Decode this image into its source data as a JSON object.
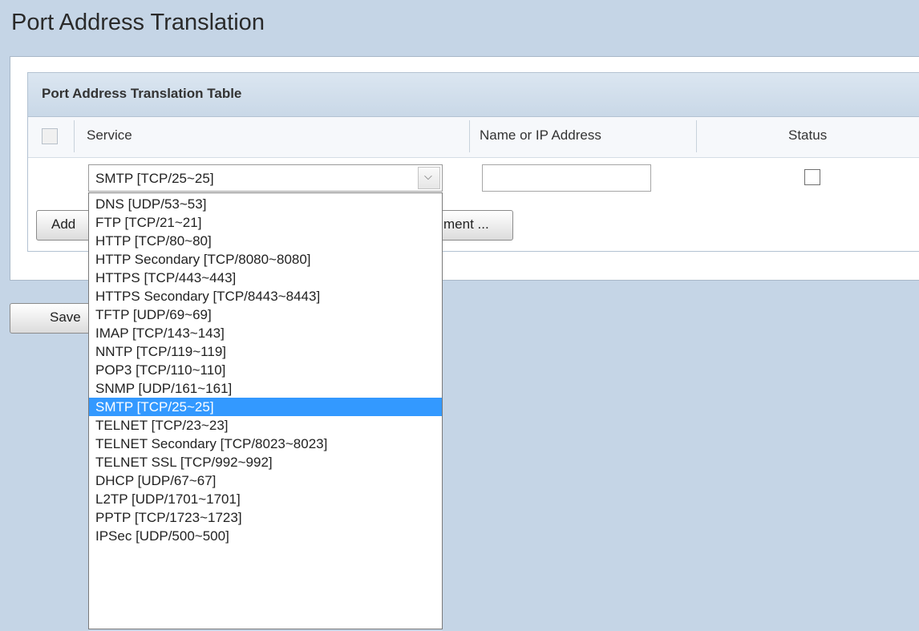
{
  "page": {
    "title": "Port Address Translation"
  },
  "table": {
    "title": "Port Address Translation Table",
    "columns": {
      "service": "Service",
      "name_or_ip": "Name or IP Address",
      "status": "Status"
    }
  },
  "row": {
    "service_selected": "SMTP [TCP/25~25]",
    "name_or_ip_value": "",
    "status_checked": false
  },
  "buttons": {
    "add_visible": "Add",
    "service_management_visible": "ment ...",
    "save_visible": "Save"
  },
  "dropdown": {
    "options": [
      "DNS [UDP/53~53]",
      "FTP [TCP/21~21]",
      "HTTP [TCP/80~80]",
      "HTTP Secondary [TCP/8080~8080]",
      "HTTPS [TCP/443~443]",
      "HTTPS Secondary [TCP/8443~8443]",
      "TFTP [UDP/69~69]",
      "IMAP [TCP/143~143]",
      "NNTP [TCP/119~119]",
      "POP3 [TCP/110~110]",
      "SNMP [UDP/161~161]",
      "SMTP [TCP/25~25]",
      "TELNET [TCP/23~23]",
      "TELNET Secondary [TCP/8023~8023]",
      "TELNET SSL [TCP/992~992]",
      "DHCP [UDP/67~67]",
      "L2TP [UDP/1701~1701]",
      "PPTP [TCP/1723~1723]",
      "IPSec [UDP/500~500]"
    ],
    "selected_index": 11
  },
  "icons": {
    "dropdown_arrow": "chevron-down-icon"
  },
  "colors": {
    "highlight": "#3399ff",
    "background": "#c5d5e6",
    "header": "#d4e0ec"
  }
}
